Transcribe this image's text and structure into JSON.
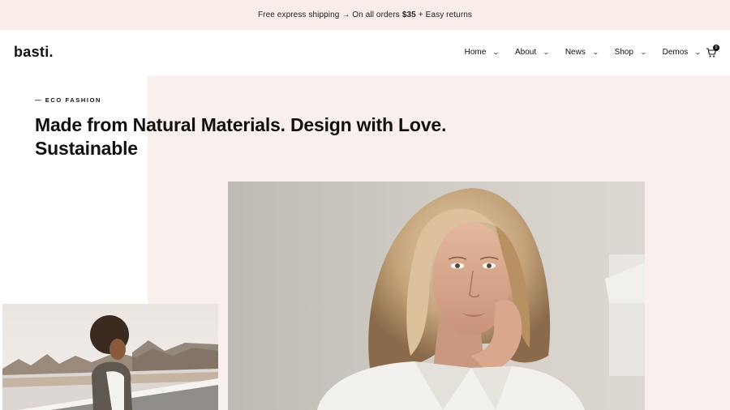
{
  "promo": {
    "text_before": "Free express shipping → On all orders",
    "price": "$35",
    "text_after": "+ Easy returns"
  },
  "header": {
    "logo": "basti.",
    "nav": [
      {
        "label": "Home"
      },
      {
        "label": "About"
      },
      {
        "label": "News"
      },
      {
        "label": "Shop"
      },
      {
        "label": "Demos"
      }
    ],
    "cart_count": "0"
  },
  "hero": {
    "eyebrow": "— ECO FASHION",
    "headline_line1": "Made from Natural Materials. Design with Love.",
    "headline_line2": "Sustainable"
  },
  "colors": {
    "promo_bg": "#f9ede9",
    "hero_bg": "#f9efec",
    "text": "#111111"
  },
  "icons": {
    "nav_chevron": "chevron-down-icon",
    "cart": "cart-icon"
  }
}
